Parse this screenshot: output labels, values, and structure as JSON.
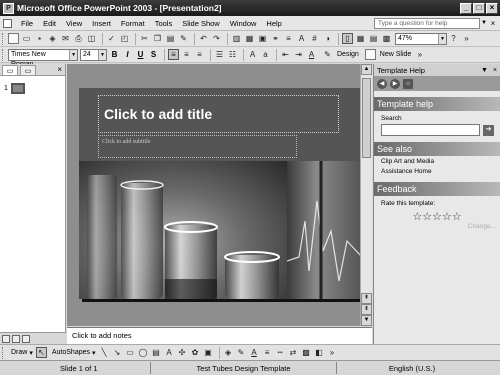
{
  "window": {
    "title": "Microsoft Office PowerPoint 2003 - [Presentation2]"
  },
  "menu": {
    "items": [
      "File",
      "Edit",
      "View",
      "Insert",
      "Format",
      "Tools",
      "Slide Show",
      "Window",
      "Help"
    ],
    "help_placeholder": "Type a question for help"
  },
  "toolbar": {
    "zoom": "47%"
  },
  "formatting": {
    "font": "Times New Roman",
    "size": "24",
    "bold": "B",
    "italic": "I",
    "underline": "U",
    "shadow": "S",
    "design": "Design",
    "new_slide": "New Slide"
  },
  "slides_pane": {
    "slide_number": "1"
  },
  "slide": {
    "title_placeholder": "Click to add title",
    "subtitle_placeholder": "Click to add subtitle"
  },
  "notes": {
    "placeholder": "Click to add notes"
  },
  "task_pane": {
    "header": "Template Help",
    "section_help": "Template help",
    "search_label": "Search",
    "section_see_also": "See also",
    "links": [
      "Clip Art and Media",
      "Assistance Home"
    ],
    "section_feedback": "Feedback",
    "rate_label": "Rate this template:",
    "stars": "☆☆☆☆☆",
    "change": "Change..."
  },
  "drawing": {
    "draw": "Draw",
    "autoshapes": "AutoShapes"
  },
  "status": {
    "slide": "Slide 1 of 1",
    "template": "Test Tubes Design Template",
    "language": "English (U.S.)"
  }
}
